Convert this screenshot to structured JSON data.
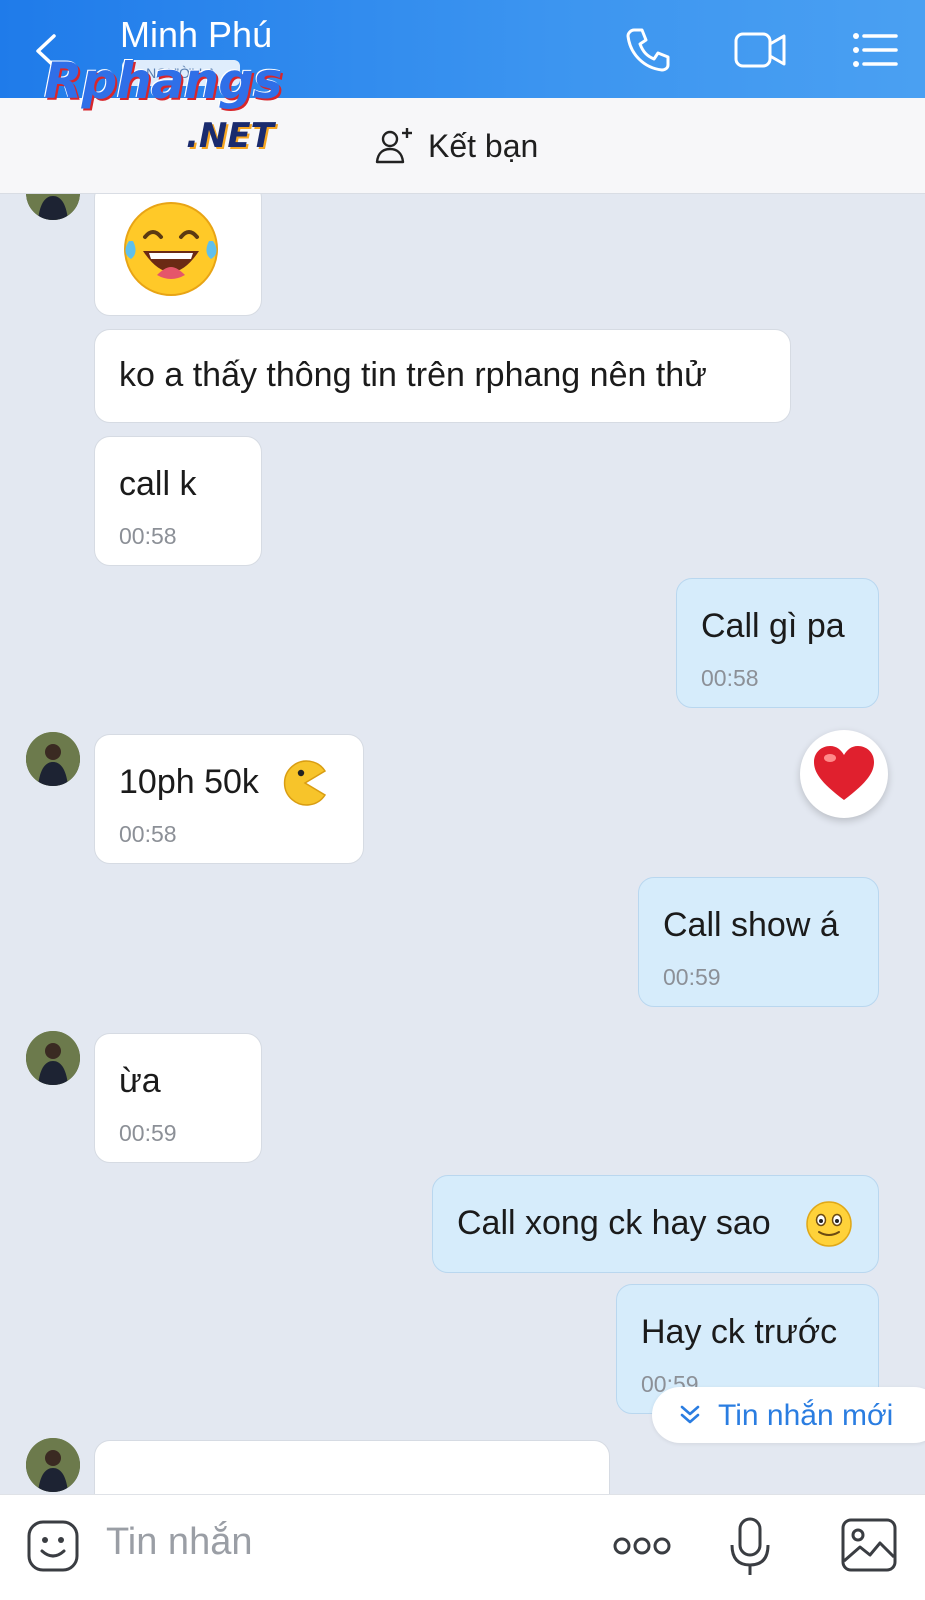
{
  "header": {
    "contact_name": "Minh Phú",
    "sub_badge": "NGƯỜI LẠ",
    "back_icon": "chevron-left-icon",
    "call_icon": "phone-icon",
    "video_icon": "video-camera-icon",
    "menu_icon": "list-menu-icon"
  },
  "watermark": {
    "main": "Rphangs",
    "suffix": ".NET"
  },
  "friend_bar": {
    "label": "Kết bạn",
    "icon": "add-user-icon"
  },
  "messages": [
    {
      "side": "in",
      "type": "sticker",
      "emoji": "😂"
    },
    {
      "side": "in",
      "text": "ko a thấy thông tin trên rphang nên thử"
    },
    {
      "side": "in",
      "text": "call k",
      "time": "00:58"
    },
    {
      "side": "out",
      "text": "Call gì pa",
      "time": "00:58",
      "reaction": "❤"
    },
    {
      "side": "in",
      "text": "10ph 50k",
      "emoji": "pacman",
      "time": "00:58"
    },
    {
      "side": "out",
      "text": "Call show á",
      "time": "00:59"
    },
    {
      "side": "in",
      "text": "ừa",
      "time": "00:59"
    },
    {
      "side": "out",
      "text": "Call xong ck hay sao",
      "emoji": "🙂"
    },
    {
      "side": "out",
      "text": "Hay ck trước",
      "time": "00:59"
    }
  ],
  "new_message_pill": {
    "label": "Tin nhắn mới",
    "icon": "double-chevron-down-icon"
  },
  "input_bar": {
    "placeholder": "Tin nhắn",
    "sticker_icon": "sticker-face-icon",
    "more_icon": "more-dots-icon",
    "mic_icon": "microphone-icon",
    "image_icon": "image-icon"
  },
  "colors": {
    "header": "#2c89ee",
    "accent": "#2a7de1",
    "out_bubble": "#d6ecfb",
    "chat_bg": "#e3e8f1"
  }
}
